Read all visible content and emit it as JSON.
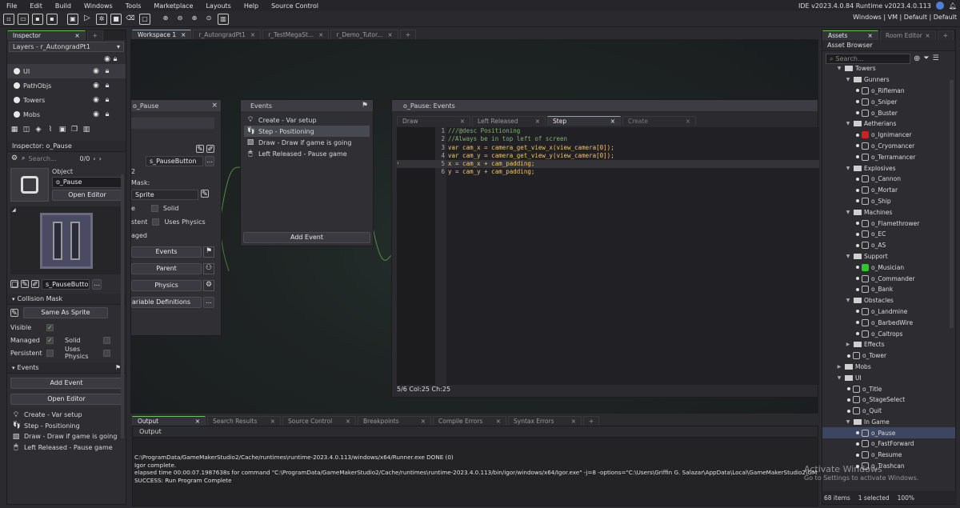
{
  "menu": [
    "File",
    "Edit",
    "Build",
    "Windows",
    "Tools",
    "Marketplace",
    "Layouts",
    "Help",
    "Source Control"
  ],
  "version": "IDE v2023.4.0.84  Runtime v2023.4.0.113",
  "layout_menu": "Windows | VM | Default | Default",
  "inspector": {
    "tab": "Inspector",
    "layers_label": "Layers - r_AutongradPt1",
    "layers": [
      {
        "name": "UI",
        "selected": true
      },
      {
        "name": "PathObjs",
        "selected": false
      },
      {
        "name": "Towers",
        "selected": false
      },
      {
        "name": "Mobs",
        "selected": false
      }
    ],
    "object_header": "Inspector: o_Pause",
    "search_placeholder": "Search...",
    "search_count": "0/0",
    "object_label": "Object",
    "object_name": "o_Pause",
    "open_editor": "Open Editor",
    "sprite_name": "s_PauseButton",
    "collision_mask": "Collision Mask",
    "same_as_sprite": "Same As Sprite",
    "visible": "Visible",
    "managed": "Managed",
    "solid": "Solid",
    "persistent": "Persistent",
    "uses_physics": "Uses Physics",
    "events": "Events",
    "add_event": "Add Event",
    "open_editor2": "Open Editor",
    "event_list": [
      "Create - Var setup",
      "Step - Positioning",
      "Draw - Draw if game is going",
      "Left Released - Pause game"
    ]
  },
  "workspace_tabs": [
    "Workspace 1",
    "r_AutongradPt1",
    "r_TestMegaSt...",
    "r_Demo_Tutor..."
  ],
  "object_window": {
    "title": "o_Pause",
    "sprite": "s_PauseButton",
    "mask_label": "Mask:",
    "mask_value": "Sprite",
    "solid": "Solid",
    "persistent": "stent",
    "uses_physics": "Uses Physics",
    "managed": "aged",
    "btn_events": "Events",
    "btn_parent": "Parent",
    "btn_physics": "Physics",
    "btn_vardefs": "ariable Definitions",
    "row2": "2"
  },
  "events_window": {
    "title": "Events",
    "items": [
      "Create - Var setup",
      "Step - Positioning",
      "Draw - Draw if game is going",
      "Left Released - Pause game"
    ],
    "add_event": "Add Event"
  },
  "code_window": {
    "title": "o_Pause: Events",
    "tabs": [
      "Draw",
      "Left Released",
      "Step",
      "Create"
    ],
    "lines": [
      {
        "n": "1",
        "text": "///@desc Positioning"
      },
      {
        "n": "2",
        "text": "//Always be in top left of screen"
      },
      {
        "n": "3",
        "text": "var cam_x = camera_get_view_x(view_camera[0]);"
      },
      {
        "n": "4",
        "text": "var cam_y = camera_get_view_y(view_camera[0]);"
      },
      {
        "n": "5",
        "text": "x = cam_x + cam_padding;"
      },
      {
        "n": "6",
        "text": "y = cam_y + cam_padding;"
      }
    ],
    "status": "5/6 Col:25 Ch:25"
  },
  "output": {
    "tabs": [
      "Output",
      "Search Results",
      "Source Control",
      "Breakpoints",
      "Compile Errors",
      "Syntax Errors"
    ],
    "header": "Output",
    "lines": [
      "C:\\ProgramData/GameMakerStudio2/Cache/runtimes\\runtime-2023.4.0.113/windows/x64/Runner.exe DONE (0)",
      "Igor complete.",
      "elapsed time 00:00:07.1987638s for command \"C:\\ProgramData/GameMakerStudio2/Cache/runtimes\\runtime-2023.4.0.113/bin/igor/windows/x64/Igor.exe\" -j=8  -options=\"C:\\Users\\Griffin G. Salazar\\AppData\\Local\\GameMakerStudio2\\GMS2",
      "SUCCESS: Run Program Complete"
    ]
  },
  "assets": {
    "tabs": [
      "Assets",
      "Room Editor"
    ],
    "title": "Asset Browser",
    "search_placeholder": "Search...",
    "tree": [
      {
        "label": "Towers",
        "lvl": 1,
        "type": "folder"
      },
      {
        "label": "Gunners",
        "lvl": 2,
        "type": "folder"
      },
      {
        "label": "o_Rifleman",
        "lvl": 3,
        "type": "obj"
      },
      {
        "label": "o_Sniper",
        "lvl": 3,
        "type": "obj"
      },
      {
        "label": "o_Buster",
        "lvl": 3,
        "type": "obj"
      },
      {
        "label": "Aetherians",
        "lvl": 2,
        "type": "folder"
      },
      {
        "label": "o_Ignimancer",
        "lvl": 3,
        "type": "obj",
        "color": "#d02020"
      },
      {
        "label": "o_Cryomancer",
        "lvl": 3,
        "type": "obj"
      },
      {
        "label": "o_Terramancer",
        "lvl": 3,
        "type": "obj"
      },
      {
        "label": "Explosives",
        "lvl": 2,
        "type": "folder"
      },
      {
        "label": "o_Cannon",
        "lvl": 3,
        "type": "obj"
      },
      {
        "label": "o_Mortar",
        "lvl": 3,
        "type": "obj"
      },
      {
        "label": "o_Ship",
        "lvl": 3,
        "type": "obj"
      },
      {
        "label": "Machines",
        "lvl": 2,
        "type": "folder"
      },
      {
        "label": "o_Flamethrower",
        "lvl": 3,
        "type": "obj"
      },
      {
        "label": "o_EC",
        "lvl": 3,
        "type": "obj"
      },
      {
        "label": "o_AS",
        "lvl": 3,
        "type": "obj"
      },
      {
        "label": "Support",
        "lvl": 2,
        "type": "folder"
      },
      {
        "label": "o_Musician",
        "lvl": 3,
        "type": "obj",
        "color": "#2ec82e"
      },
      {
        "label": "o_Commander",
        "lvl": 3,
        "type": "obj"
      },
      {
        "label": "o_Bank",
        "lvl": 3,
        "type": "obj"
      },
      {
        "label": "Obstacles",
        "lvl": 2,
        "type": "folder"
      },
      {
        "label": "o_Landmine",
        "lvl": 3,
        "type": "obj"
      },
      {
        "label": "o_BarbedWire",
        "lvl": 3,
        "type": "obj"
      },
      {
        "label": "o_Caltrops",
        "lvl": 3,
        "type": "obj"
      },
      {
        "label": "Effects",
        "lvl": 2,
        "type": "folder",
        "closed": true
      },
      {
        "label": "o_Tower",
        "lvl": 2,
        "type": "obj"
      },
      {
        "label": "Mobs",
        "lvl": 1,
        "type": "folder",
        "closed": true
      },
      {
        "label": "UI",
        "lvl": 1,
        "type": "folder"
      },
      {
        "label": "o_Title",
        "lvl": 2,
        "type": "obj"
      },
      {
        "label": "o_StageSelect",
        "lvl": 2,
        "type": "obj"
      },
      {
        "label": "o_Quit",
        "lvl": 2,
        "type": "obj"
      },
      {
        "label": "In Game",
        "lvl": 2,
        "type": "folder"
      },
      {
        "label": "o_Pause",
        "lvl": 3,
        "type": "obj",
        "selected": true
      },
      {
        "label": "o_FastForward",
        "lvl": 3,
        "type": "obj"
      },
      {
        "label": "o_Resume",
        "lvl": 3,
        "type": "obj"
      },
      {
        "label": "o_Trashcan",
        "lvl": 3,
        "type": "obj"
      }
    ],
    "status_items": "68 items",
    "status_selected": "1 selected",
    "zoom": "100%"
  },
  "watermark": {
    "title": "Activate Windows",
    "subtitle": "Go to Settings to activate Windows."
  }
}
